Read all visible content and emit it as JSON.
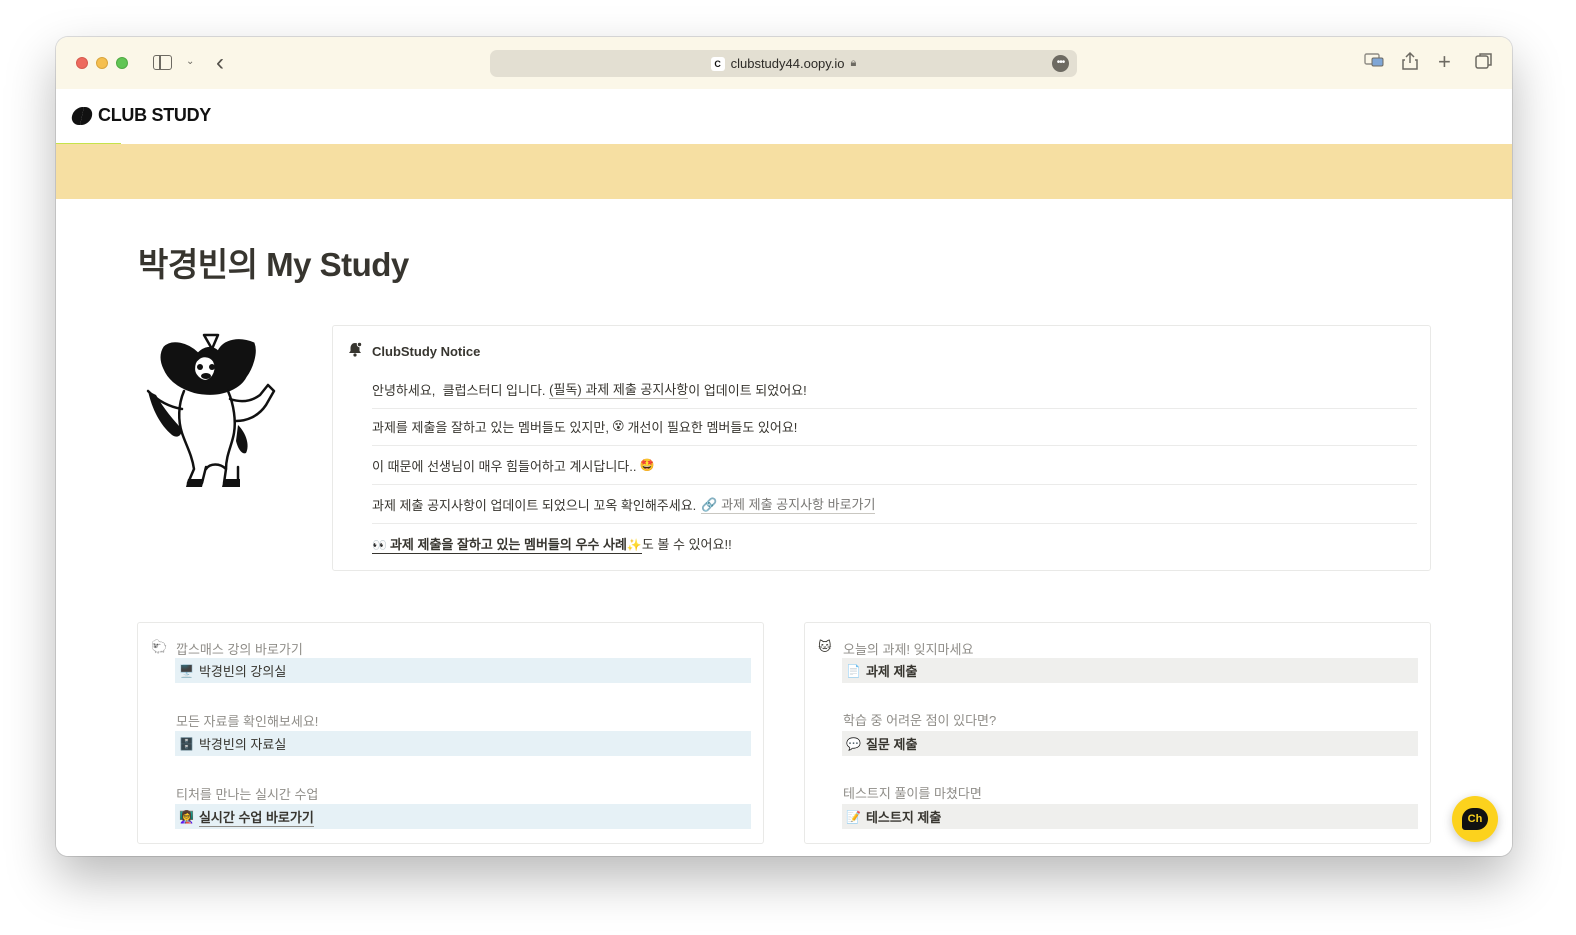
{
  "browser": {
    "url": "clubstudy44.oopy.io",
    "favicon_text": "C"
  },
  "header": {
    "logo_text": "CLUB STUDY"
  },
  "page": {
    "title": "박경빈의 My Study"
  },
  "notice": {
    "title": "ClubStudy Notice",
    "line1": {
      "prefix": "안녕하세요,  클럽스터디 입니다. ",
      "link": "(필독) 과제 제출 공지사항",
      "suffix": "이 업데이트 되었어요!"
    },
    "line2": {
      "prefix": "과제를 제출을 잘하고 있는 멤버들도 있지만,",
      "emoji": "😵",
      "suffix": "개선이 필요한 멤버들도 있어요!"
    },
    "line3": {
      "text": "이 때문에 선생님이 매우 힘들어하고 계시답니다..",
      "emoji": "🤩"
    },
    "line4": {
      "prefix": "과제 제출 공지사항이 업데이트 되었으니 꼬옥 확인해주세요.",
      "link": "🔗 과제 제출 공지사항 바로가기"
    },
    "line5": {
      "emoji": "👀",
      "link": "과제 제출을 잘하고 있는 멤버들의 우수 사례",
      "sparkle": "✨",
      "suffix": "도 볼 수 있어요!!"
    }
  },
  "left_card": {
    "icon": "🐑",
    "items": [
      {
        "label": "깝스매스 강의 바로가기",
        "emoji": "🖥️",
        "text": "박경빈의 강의실"
      },
      {
        "label": "모든 자료를 확인해보세요!",
        "emoji": "🗄️",
        "text": "박경빈의 자료실"
      },
      {
        "label": "티처를 만나는 실시간 수업",
        "emoji": "👩‍🏫",
        "text": "실시간 수업 바로가기"
      }
    ]
  },
  "right_card": {
    "icon": "🐱",
    "items": [
      {
        "label": "오늘의 과제! 잊지마세요",
        "emoji": "📄",
        "text": "과제 제출"
      },
      {
        "label": "학습 중 어려운 점이 있다면?",
        "emoji": "💬",
        "text": "질문 제출"
      },
      {
        "label": "테스트지 풀이를 마쳤다면",
        "emoji": "📝",
        "text": "테스트지 제출"
      }
    ]
  },
  "chat": {
    "label": "Ch",
    "color": "#fcd21d"
  },
  "colors": {
    "banner": "#f6dfa2",
    "chrome": "#fbf7e8",
    "left_bar": "#e6f1f6",
    "right_bar": "#efefed"
  }
}
